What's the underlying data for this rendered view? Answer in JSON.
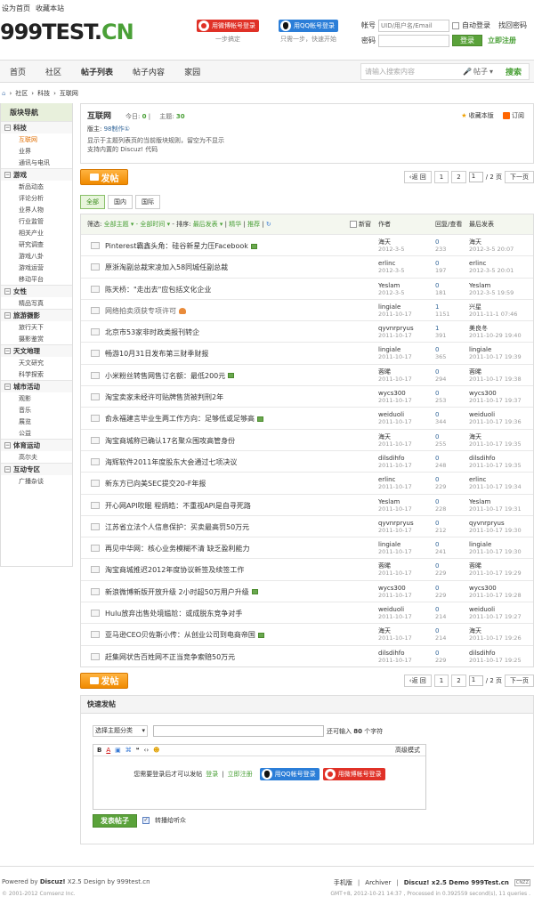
{
  "topbar": {
    "set_home": "设为首页",
    "bookmark": "收藏本站"
  },
  "logo": {
    "main": "999TEST.",
    "suffix": "CN"
  },
  "social": {
    "weibo_login": "用微博帐号登录",
    "weibo_hint": "一步搞定",
    "qq_login": "用QQ帐号登录",
    "qq_hint": "只需一步，快速开始"
  },
  "login": {
    "account_label": "帐号",
    "account_placeholder": "UID/用户名/Email",
    "auto_login": "自动登录",
    "forgot": "找回密码",
    "password_label": "密码",
    "login_btn": "登录",
    "register": "立即注册"
  },
  "nav": {
    "items": [
      "首页",
      "社区",
      "帖子列表",
      "帖子内容",
      "家园"
    ],
    "search_placeholder": "请输入搜索内容",
    "search_scope": "帖子",
    "search_btn": "搜索"
  },
  "breadcrumb": [
    "社区",
    "科技",
    "互联网"
  ],
  "sidebar": {
    "title": "版块导航",
    "groups": [
      {
        "name": "科技",
        "items": [
          "互联网",
          "业界",
          "通讯与电讯"
        ]
      },
      {
        "name": "游戏",
        "items": [
          "新品动态",
          "评论分析",
          "业界人物",
          "行业监管",
          "相关产业",
          "研究调查",
          "游戏八卦",
          "游戏运营",
          "移动平台"
        ]
      },
      {
        "name": "女性",
        "items": [
          "精品写真"
        ]
      },
      {
        "name": "旅游摄影",
        "items": [
          "旅行天下",
          "摄影鉴赏"
        ]
      },
      {
        "name": "天文地理",
        "items": [
          "天文研究",
          "科学探索"
        ]
      },
      {
        "name": "城市活动",
        "items": [
          "观影",
          "音乐",
          "展览",
          "公益"
        ]
      },
      {
        "name": "体育运动",
        "items": [
          "高尔夫"
        ]
      },
      {
        "name": "互动专区",
        "items": [
          "广播杂谈"
        ]
      }
    ]
  },
  "forum": {
    "name": "互联网",
    "today_label": "今日:",
    "today": "0",
    "topics_label": "主题:",
    "topics": "30",
    "moderator_label": "版主:",
    "moderator": "98制作①",
    "desc1": "显示于主题列表页的当前版块规则，留空为不显示",
    "desc2": "支持内置的 Discuz! 代码",
    "bookmark": "收藏本版",
    "subscribe": "订阅"
  },
  "post_btn": "发帖",
  "pager": {
    "back": "返 回",
    "p1": "1",
    "p2": "2",
    "cur": "1",
    "total": "/ 2 页",
    "next": "下一页"
  },
  "tabs": [
    "全部",
    "国内",
    "国际"
  ],
  "filter": {
    "label": "筛选:",
    "all_topics": "全部主题",
    "all_time": "全部时间",
    "sort_label": "排序:",
    "sort": "最后发表",
    "digest": "精华",
    "recommend": "推荐",
    "newwin": "新窗",
    "author": "作者",
    "replies": "回复/查看",
    "last": "最后发表"
  },
  "threads": [
    {
      "title": "Pinterest霸鑫头角：硅谷新星力压Facebook",
      "author": "海天",
      "date": "2012-3-5",
      "replies": "0",
      "views": "233",
      "last_user": "海天",
      "last_time": "2012-3-5 20:07",
      "img": true,
      "gray": false
    },
    {
      "title": "原浙淘副总裁宋凌加入58同城任副总裁",
      "author": "erlinc",
      "date": "2012-3-5",
      "replies": "0",
      "views": "197",
      "last_user": "erlinc",
      "last_time": "2012-3-5 20:01",
      "img": false,
      "gray": false
    },
    {
      "title": "陈天桥：\"走出去\"应包括文化企业",
      "author": "Yeslam",
      "date": "2012-3-5",
      "replies": "0",
      "views": "181",
      "last_user": "Yeslam",
      "last_time": "2012-3-5 19:59",
      "img": false,
      "gray": false
    },
    {
      "title": "网络拍卖须获专项许可",
      "author": "lingiale",
      "date": "2011-10-17",
      "replies": "1",
      "views": "1151",
      "last_user": "兴星",
      "last_time": "2011-11-1 07:46",
      "img": false,
      "gray": true,
      "hot": true
    },
    {
      "title": "北京市53家非时政类报刊转企",
      "author": "qyvnrpryus",
      "date": "2011-10-17",
      "replies": "1",
      "views": "391",
      "last_user": "美良冬",
      "last_time": "2011-10-29 19:40",
      "img": false,
      "gray": false
    },
    {
      "title": "畅游10月31日发布第三财季财报",
      "author": "lingiale",
      "date": "2011-10-17",
      "replies": "0",
      "views": "365",
      "last_user": "lingiale",
      "last_time": "2011-10-17 19:39",
      "img": false,
      "gray": false
    },
    {
      "title": "小米粉丝转售网售订名额：最低200元",
      "author": "蓉晞",
      "date": "2011-10-17",
      "replies": "0",
      "views": "294",
      "last_user": "蓉晞",
      "last_time": "2011-10-17 19:38",
      "img": true,
      "gray": false
    },
    {
      "title": "淘宝卖家未经许可贴牌售货被判刑2年",
      "author": "wycs300",
      "date": "2011-10-17",
      "replies": "0",
      "views": "253",
      "last_user": "wycs300",
      "last_time": "2011-10-17 19:37",
      "img": false,
      "gray": false
    },
    {
      "title": "俞永福建言毕业生两工作方向：足够低或足够高",
      "author": "weiduoli",
      "date": "2011-10-17",
      "replies": "0",
      "views": "344",
      "last_user": "weiduoli",
      "last_time": "2011-10-17 19:36",
      "img": true,
      "gray": false
    },
    {
      "title": "淘宝商城称已确认17名聚众围攻高管身份",
      "author": "海天",
      "date": "2011-10-17",
      "replies": "0",
      "views": "255",
      "last_user": "海天",
      "last_time": "2011-10-17 19:35",
      "img": false,
      "gray": false
    },
    {
      "title": "海辉软件2011年度股东大会通过七项决议",
      "author": "dilsdihfo",
      "date": "2011-10-17",
      "replies": "0",
      "views": "248",
      "last_user": "dilsdihfo",
      "last_time": "2011-10-17 19:35",
      "img": false,
      "gray": false
    },
    {
      "title": "新东方已向美SEC提交20-F年报",
      "author": "erlinc",
      "date": "2011-10-17",
      "replies": "0",
      "views": "229",
      "last_user": "erlinc",
      "last_time": "2011-10-17 19:34",
      "img": false,
      "gray": false
    },
    {
      "title": "开心网API吹眠 程炳皓：不重视API是自寻死路",
      "author": "Yeslam",
      "date": "2011-10-17",
      "replies": "0",
      "views": "228",
      "last_user": "Yeslam",
      "last_time": "2011-10-17 19:31",
      "img": false,
      "gray": false
    },
    {
      "title": "江苏省立法个人信息保护：买卖最高罚50万元",
      "author": "qyvnrpryus",
      "date": "2011-10-17",
      "replies": "0",
      "views": "212",
      "last_user": "qyvnrpryus",
      "last_time": "2011-10-17 19:30",
      "img": false,
      "gray": false
    },
    {
      "title": "再见中华网：核心业务模糊不清 缺乏盈利能力",
      "author": "lingiale",
      "date": "2011-10-17",
      "replies": "0",
      "views": "241",
      "last_user": "lingiale",
      "last_time": "2011-10-17 19:30",
      "img": false,
      "gray": false
    },
    {
      "title": "淘宝商城推迟2012年度协议新签及续签工作",
      "author": "蓉晞",
      "date": "2011-10-17",
      "replies": "0",
      "views": "229",
      "last_user": "蓉晞",
      "last_time": "2011-10-17 19:29",
      "img": false,
      "gray": false
    },
    {
      "title": "新浪微博新版开放升级 2小时超50万用户升级",
      "author": "wycs300",
      "date": "2011-10-17",
      "replies": "0",
      "views": "229",
      "last_user": "wycs300",
      "last_time": "2011-10-17 19:28",
      "img": true,
      "gray": false
    },
    {
      "title": "Hulu放弃出售处境尴尬：或成脱东竞争对手",
      "author": "weiduoli",
      "date": "2011-10-17",
      "replies": "0",
      "views": "214",
      "last_user": "weiduoli",
      "last_time": "2011-10-17 19:27",
      "img": false,
      "gray": false
    },
    {
      "title": "亚马逊CEO贝佐斯小传：从创业公司到电商帝国",
      "author": "海天",
      "date": "2011-10-17",
      "replies": "0",
      "views": "214",
      "last_user": "海天",
      "last_time": "2011-10-17 19:26",
      "img": true,
      "gray": false
    },
    {
      "title": "赶集网状告百姓网不正当竞争索赔50万元",
      "author": "dilsdihfo",
      "date": "2011-10-17",
      "replies": "0",
      "views": "229",
      "last_user": "dilsdihfo",
      "last_time": "2011-10-17 19:25",
      "img": false,
      "gray": false
    }
  ],
  "quickpost": {
    "title": "快速发帖",
    "type_select": "选择主题分类",
    "count_prefix": "还可输入",
    "count": "80",
    "count_suffix": "个字符",
    "advanced": "高级模式",
    "need_login": "您需要登录后才可以发帖",
    "login": "登录",
    "register": "立即注册",
    "qq_login": "用QQ帐号登录",
    "weibo_login": "用微博帐号登录",
    "submit": "发表帖子",
    "sync": "转播给听众"
  },
  "footer": {
    "powered": "Powered by",
    "discuz": "Discuz!",
    "version": "X2.5 Design by 999test.cn",
    "copyright": "© 2001-2012 Comsenz Inc.",
    "mobile": "手机版",
    "archiver": "Archiver",
    "demo": "Discuz! x2.5 Demo 999Test.cn",
    "badge": "CNZZ",
    "stats": "GMT+8, 2012-10-21 14:37 , Processed in 0.392559 second(s), 11 queries ."
  }
}
